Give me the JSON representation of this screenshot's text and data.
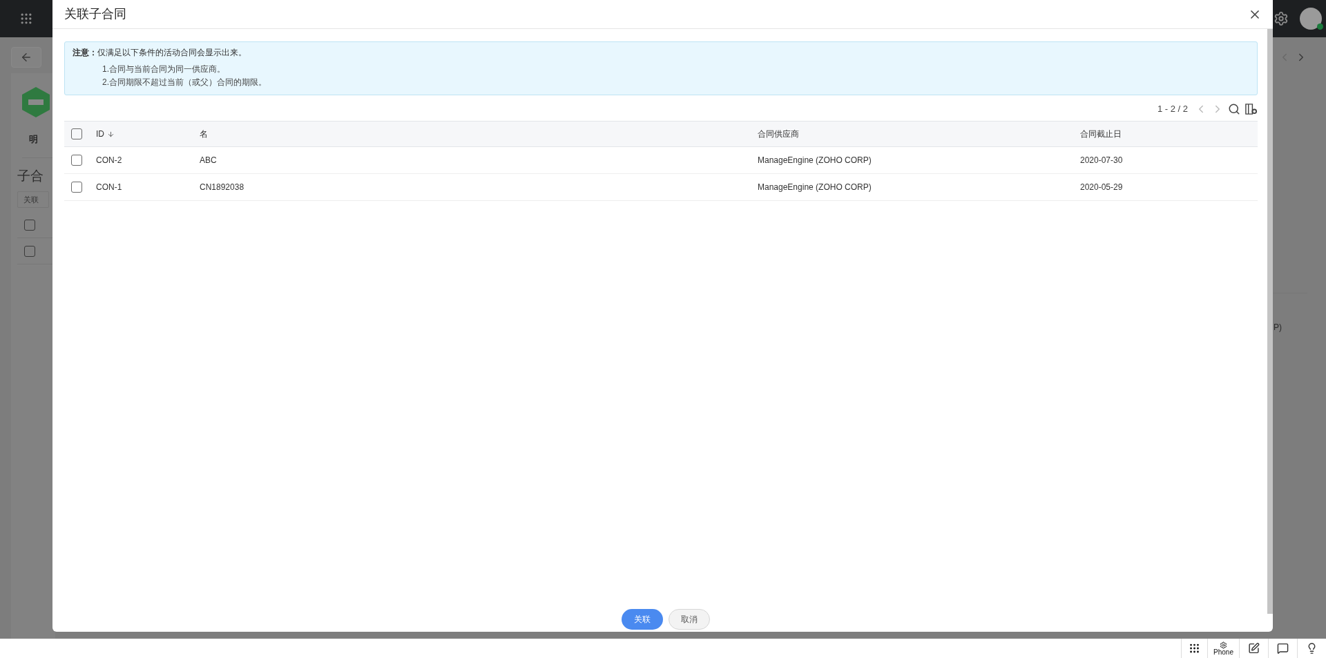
{
  "backdrop": {
    "detail_tab": "明",
    "section_title": "子合",
    "link_button": "关联",
    "rows": [
      {
        "checked": false
      },
      {
        "checked": false
      }
    ],
    "side_text": "P)"
  },
  "modal": {
    "title": "关联子合同",
    "notice": {
      "text": "**注意：**仅满足以下条件的活动合同会显示出来。",
      "conditions": [
        "1.合同与当前合同为同一供应商。",
        "2.合同期限不超过当前（或父）合同的期限。"
      ]
    },
    "toolbar": {
      "range": "1 - 2 / 2"
    },
    "table": {
      "select_all": {
        "checked": false
      },
      "columns": [
        {
          "label": "ID",
          "sorted": true
        },
        {
          "label": "名",
          "sorted": false
        },
        {
          "label": "合同供应商",
          "sorted": false
        },
        {
          "label": "合同截止日",
          "sorted": false
        }
      ],
      "rows": [
        {
          "checked": false,
          "cells": [
            "CON-2",
            "ABC",
            "ManageEngine (ZOHO CORP)",
            "2020-07-30"
          ]
        },
        {
          "checked": false,
          "cells": [
            "CON-1",
            "CN1892038",
            "ManageEngine (ZOHO CORP)",
            "2020-05-29"
          ]
        }
      ]
    },
    "buttons": [
      {
        "label": "关联",
        "kind": "primary"
      },
      {
        "label": "取消",
        "kind": "secondary"
      }
    ]
  },
  "bottom_bar": {
    "phone_label": "Phone"
  }
}
